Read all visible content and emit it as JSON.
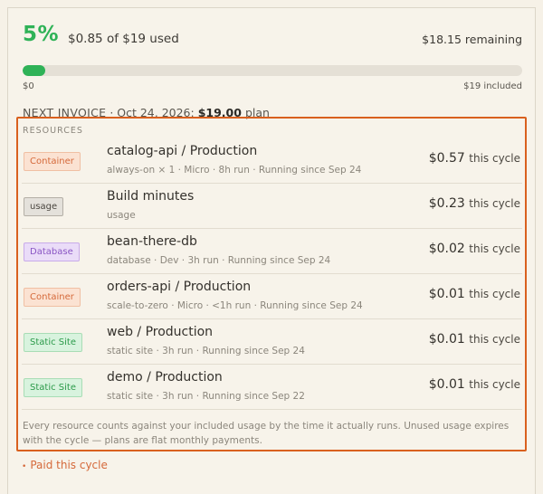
{
  "usage": {
    "percent_label": "5%",
    "used_text": "$0.85 of $19 used",
    "remaining_text": "$18.15 remaining",
    "progress_fraction": 0.045,
    "bar_min_label": "$0",
    "bar_max_label": "$19 included"
  },
  "invoice": {
    "label": "NEXT INVOICE",
    "date_text": "· Oct 24, 2026:",
    "amount": "$19.00",
    "plan_suffix": "plan"
  },
  "resources": {
    "header": "RESOURCES",
    "rows": [
      {
        "tag": "Container",
        "tag_kind": "container",
        "name": "catalog-api / Production",
        "meta": "always-on × 1 · Micro · 8h run · Running since Sep 24",
        "price": "$0.57",
        "cycle": "this cycle"
      },
      {
        "tag": "usage",
        "tag_kind": "usage",
        "name": "Build minutes",
        "meta": "usage",
        "price": "$0.23",
        "cycle": "this cycle"
      },
      {
        "tag": "Database",
        "tag_kind": "database",
        "name": "bean-there-db",
        "meta": "database · Dev · 3h run · Running since Sep 24",
        "price": "$0.02",
        "cycle": "this cycle"
      },
      {
        "tag": "Container",
        "tag_kind": "container",
        "name": "orders-api / Production",
        "meta": "scale-to-zero · Micro · <1h run · Running since Sep 24",
        "price": "$0.01",
        "cycle": "this cycle"
      },
      {
        "tag": "Static Site",
        "tag_kind": "static",
        "name": "web / Production",
        "meta": "static site · 3h run · Running since Sep 24",
        "price": "$0.01",
        "cycle": "this cycle"
      },
      {
        "tag": "Static Site",
        "tag_kind": "static",
        "name": "demo / Production",
        "meta": "static site · 3h run · Running since Sep 22",
        "price": "$0.01",
        "cycle": "this cycle"
      }
    ],
    "note": "Every resource counts against your included usage by the time it actually runs. Unused usage expires with the cycle — plans are flat monthly payments."
  },
  "footer": {
    "paid_bullet": "•",
    "paid_label": "Paid this cycle"
  },
  "colors": {
    "accent_green": "#2fb257",
    "highlight_orange": "#d9601e"
  }
}
